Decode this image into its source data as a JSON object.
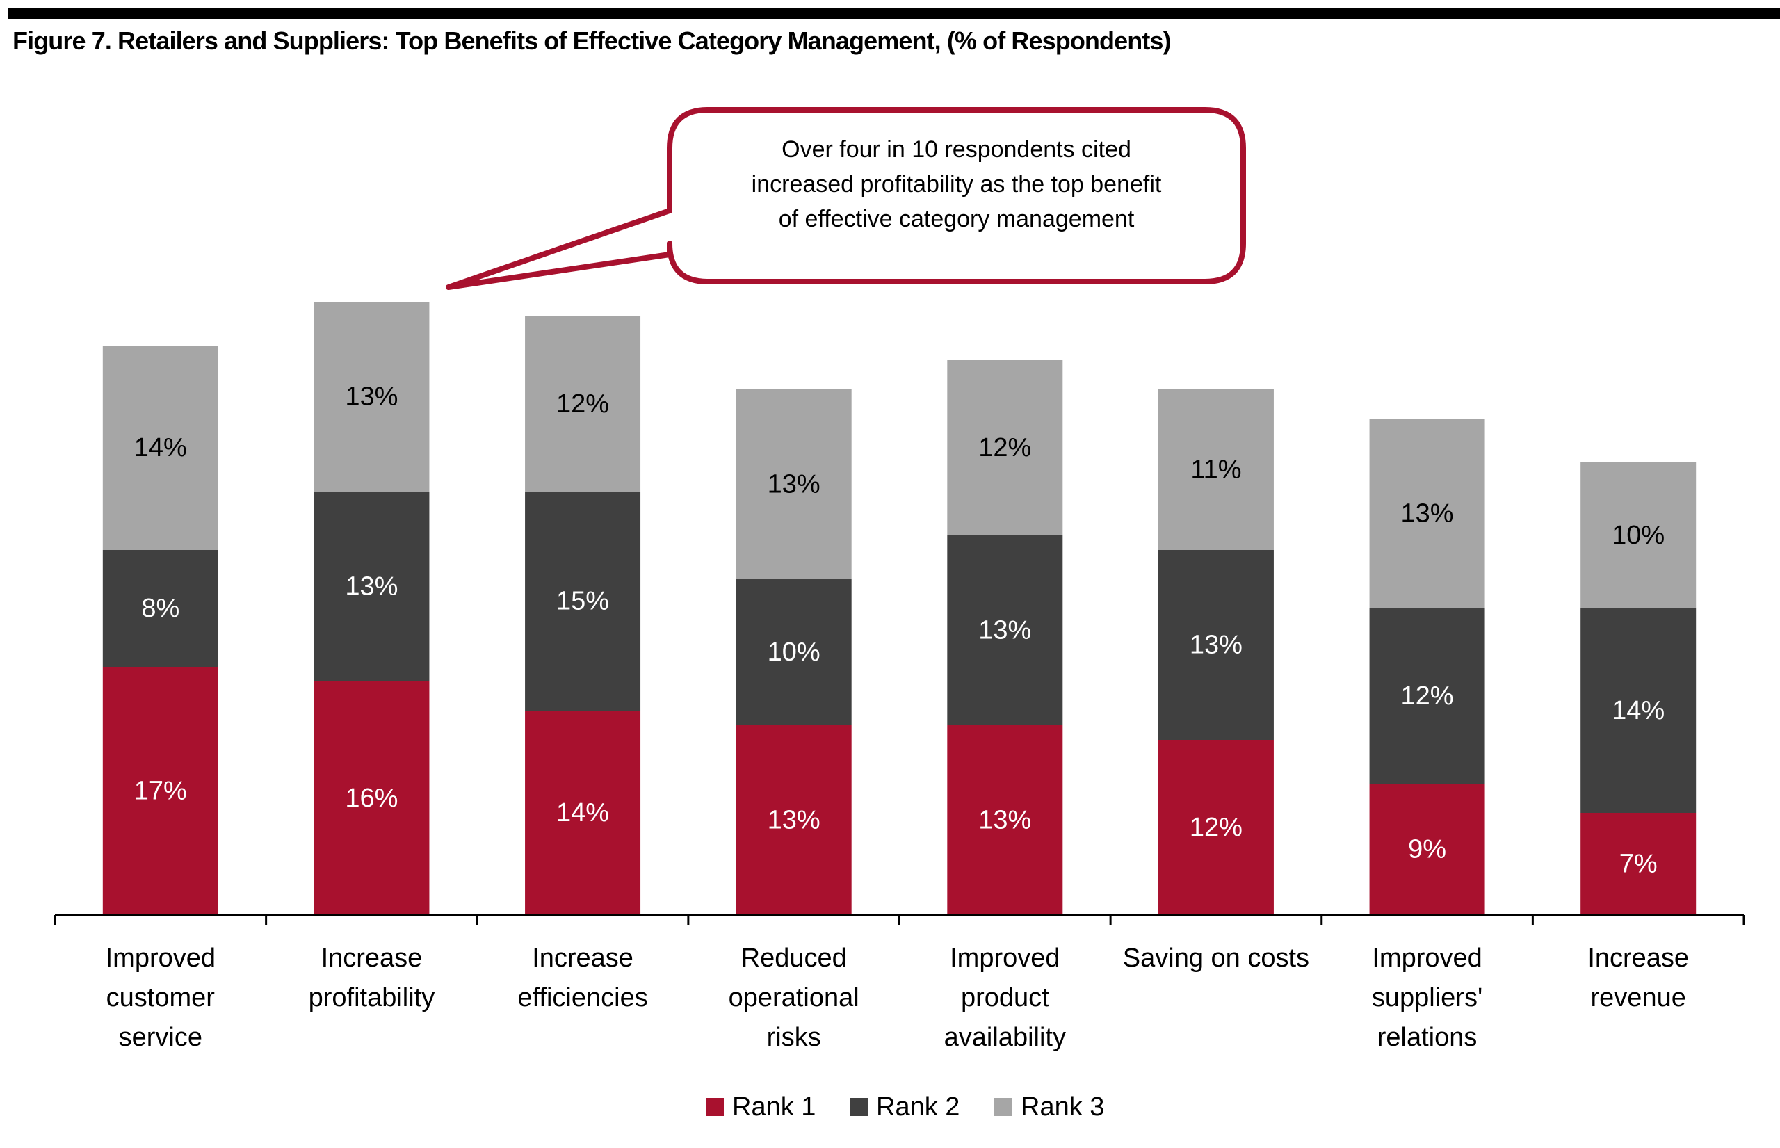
{
  "chart_data": {
    "type": "bar",
    "stacked": true,
    "title": "Figure 7. Retailers and Suppliers: Top Benefits of Effective Category Management, (% of Respondents)",
    "xlabel": "",
    "ylabel": "",
    "ylim": [
      0,
      45
    ],
    "grid": false,
    "legend_position": "bottom-center",
    "categories": [
      [
        "Improved",
        "customer",
        "service"
      ],
      [
        "Increase",
        "profitability"
      ],
      [
        "Increase",
        "efficiencies"
      ],
      [
        "Reduced",
        "operational",
        "risks"
      ],
      [
        "Improved",
        "product",
        "availability"
      ],
      [
        "Saving on costs"
      ],
      [
        "Improved",
        "suppliers'",
        "relations"
      ],
      [
        "Increase",
        "revenue"
      ]
    ],
    "series": [
      {
        "name": "Rank 1",
        "color": "#a8112e",
        "label_color": "#ffffff",
        "values": [
          17,
          16,
          14,
          13,
          13,
          12,
          9,
          7
        ]
      },
      {
        "name": "Rank 2",
        "color": "#404040",
        "label_color": "#ffffff",
        "values": [
          8,
          13,
          15,
          10,
          13,
          13,
          12,
          14
        ]
      },
      {
        "name": "Rank 3",
        "color": "#a6a6a6",
        "label_color": "#000000",
        "values": [
          14,
          13,
          12,
          13,
          12,
          11,
          13,
          10
        ]
      }
    ],
    "value_suffix": "%",
    "annotation": {
      "lines": [
        "Over four in 10 respondents cited",
        "increased profitability as the top benefit",
        "of effective category management"
      ],
      "points_to_category": "Increase profitability",
      "border_color": "#a8112e"
    }
  }
}
